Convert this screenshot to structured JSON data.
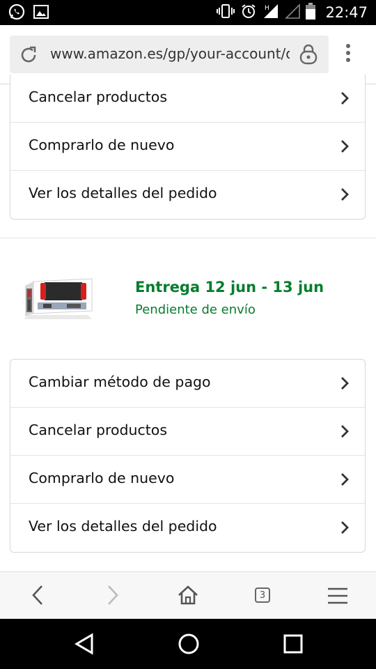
{
  "status_bar": {
    "time": "22:47",
    "icons": [
      "whatsapp-icon",
      "image-icon",
      "vibrate-icon",
      "alarm-icon",
      "signal-h-icon",
      "signal-empty-icon",
      "battery-icon"
    ]
  },
  "address_bar": {
    "url": "www.amazon.es/gp/your-account/or",
    "icons": [
      "reload-icon",
      "lock-icon",
      "overflow-menu-icon"
    ]
  },
  "order_top": {
    "actions": [
      {
        "label": "Cancelar productos"
      },
      {
        "label": "Comprarlo de nuevo"
      },
      {
        "label": "Ver los detalles del pedido"
      }
    ]
  },
  "shipment": {
    "delivery": "Entrega 12 jun - 13 jun",
    "status": "Pendiente de envío",
    "accent_color": "#067D2E",
    "actions": [
      {
        "label": "Cambiar método de pago"
      },
      {
        "label": "Cancelar productos"
      },
      {
        "label": "Comprarlo de nuevo"
      },
      {
        "label": "Ver los detalles del pedido"
      }
    ]
  },
  "browser_nav": {
    "tab_count": "3",
    "icons": [
      "back-icon",
      "forward-icon",
      "home-icon",
      "tabs-icon",
      "menu-icon"
    ]
  },
  "android_nav": {
    "icons": [
      "back-triangle-icon",
      "home-circle-icon",
      "recents-square-icon"
    ]
  }
}
